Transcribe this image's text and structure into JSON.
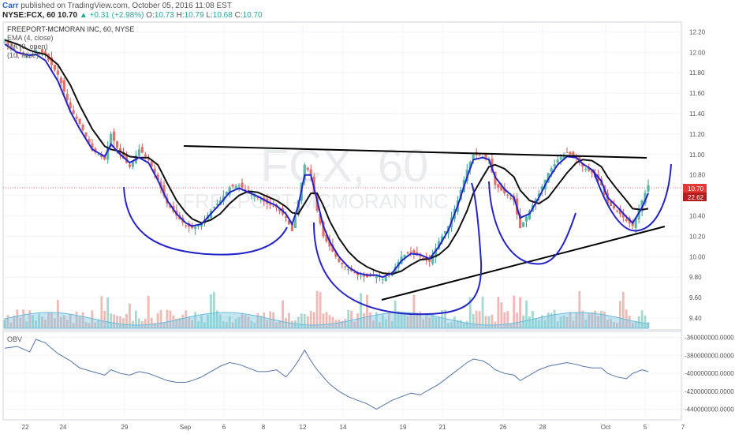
{
  "header": {
    "author": "Carr",
    "published_text": "published on TradingView.com, October 05, 2016 11:08 EST",
    "symbol": "NYSE:FCX, 60",
    "last": "10.70",
    "change": "+0.31 (+2.98%)",
    "o_label": "O:",
    "o_value": "10.73",
    "h_label": "H:",
    "h_value": "10.79",
    "l_label": "L:",
    "l_value": "10.68",
    "c_label": "C:",
    "c_value": "10.70"
  },
  "pane": {
    "title": "FREEPORT-MCMORAN INC, 60, NYSE",
    "legend": [
      "EMA (4, close)",
      "MA (9, open)",
      "(10, false)"
    ],
    "watermark_symbol": "FCX, 60",
    "watermark_name": "FREEPORT-MCMORAN INC",
    "obv_label": "OBV",
    "price_tag": "10.70",
    "price_tag_color": "#e53935",
    "secondary_tag": "22.62",
    "secondary_tag_color": "#b71c1c"
  },
  "chart_data": {
    "type": "candlestick",
    "x_ticks": [
      "22",
      "24",
      "29",
      "Sep",
      "6",
      "8",
      "12",
      "14",
      "19",
      "21",
      "26",
      "28",
      "Oct",
      "5",
      "7"
    ],
    "price_axis": {
      "ticks": [
        "12.20",
        "12.00",
        "11.80",
        "11.60",
        "11.40",
        "11.20",
        "11.00",
        "10.80",
        "10.60",
        "10.40",
        "10.20",
        "10.00",
        "9.80",
        "9.60",
        "9.40"
      ],
      "ylim": [
        9.3,
        12.28
      ]
    },
    "obv_axis": {
      "ticks": [
        "-360000000.0000",
        "-380000000.0000",
        "-400000000.0000",
        "-420000000.0000",
        "-440000000.0000"
      ],
      "ylim": [
        -450000000,
        -355000000
      ]
    },
    "price_path": [
      [
        0,
        12.1
      ],
      [
        4,
        12.0
      ],
      [
        8,
        11.95
      ],
      [
        10,
        12.02
      ],
      [
        13,
        11.97
      ],
      [
        17,
        11.78
      ],
      [
        21,
        11.45
      ],
      [
        24,
        11.3
      ],
      [
        28,
        11.05
      ],
      [
        32,
        10.95
      ],
      [
        34,
        11.2
      ],
      [
        37,
        11.0
      ],
      [
        40,
        10.88
      ],
      [
        43,
        11.05
      ],
      [
        46,
        10.95
      ],
      [
        49,
        10.75
      ],
      [
        52,
        10.52
      ],
      [
        55,
        10.4
      ],
      [
        58,
        10.3
      ],
      [
        60,
        10.28
      ],
      [
        63,
        10.32
      ],
      [
        66,
        10.45
      ],
      [
        69,
        10.55
      ],
      [
        72,
        10.68
      ],
      [
        75,
        10.7
      ],
      [
        78,
        10.62
      ],
      [
        81,
        10.58
      ],
      [
        84,
        10.52
      ],
      [
        87,
        10.48
      ],
      [
        90,
        10.38
      ],
      [
        92,
        10.25
      ],
      [
        94,
        10.55
      ],
      [
        96,
        10.9
      ],
      [
        98,
        10.8
      ],
      [
        100,
        10.45
      ],
      [
        102,
        10.2
      ],
      [
        104,
        10.1
      ],
      [
        107,
        9.95
      ],
      [
        110,
        9.88
      ],
      [
        113,
        9.82
      ],
      [
        116,
        9.8
      ],
      [
        119,
        9.82
      ],
      [
        121,
        9.78
      ],
      [
        124,
        9.85
      ],
      [
        127,
        10.0
      ],
      [
        130,
        10.05
      ],
      [
        133,
        10.0
      ],
      [
        136,
        9.95
      ],
      [
        139,
        10.15
      ],
      [
        142,
        10.3
      ],
      [
        145,
        10.55
      ],
      [
        148,
        10.85
      ],
      [
        150,
        11.0
      ],
      [
        153,
        10.98
      ],
      [
        155,
        10.95
      ],
      [
        157,
        10.7
      ],
      [
        160,
        10.62
      ],
      [
        163,
        10.55
      ],
      [
        165,
        10.28
      ],
      [
        168,
        10.45
      ],
      [
        171,
        10.62
      ],
      [
        174,
        10.82
      ],
      [
        177,
        10.95
      ],
      [
        180,
        11.02
      ],
      [
        183,
        10.96
      ],
      [
        185,
        10.88
      ],
      [
        188,
        10.82
      ],
      [
        191,
        10.7
      ],
      [
        193,
        10.52
      ],
      [
        196,
        10.45
      ],
      [
        199,
        10.35
      ],
      [
        201,
        10.3
      ],
      [
        204,
        10.55
      ],
      [
        206,
        10.7
      ]
    ],
    "ema4": [
      [
        0,
        12.08
      ],
      [
        4,
        12.0
      ],
      [
        8,
        11.97
      ],
      [
        10,
        11.98
      ],
      [
        13,
        11.92
      ],
      [
        17,
        11.72
      ],
      [
        21,
        11.42
      ],
      [
        24,
        11.25
      ],
      [
        28,
        11.05
      ],
      [
        32,
        10.98
      ],
      [
        34,
        11.1
      ],
      [
        37,
        11.0
      ],
      [
        40,
        10.92
      ],
      [
        43,
        10.97
      ],
      [
        46,
        10.92
      ],
      [
        49,
        10.75
      ],
      [
        52,
        10.55
      ],
      [
        55,
        10.42
      ],
      [
        58,
        10.33
      ],
      [
        60,
        10.3
      ],
      [
        63,
        10.32
      ],
      [
        66,
        10.42
      ],
      [
        69,
        10.52
      ],
      [
        72,
        10.63
      ],
      [
        75,
        10.67
      ],
      [
        78,
        10.63
      ],
      [
        81,
        10.59
      ],
      [
        84,
        10.54
      ],
      [
        87,
        10.5
      ],
      [
        90,
        10.42
      ],
      [
        92,
        10.32
      ],
      [
        94,
        10.5
      ],
      [
        96,
        10.8
      ],
      [
        98,
        10.8
      ],
      [
        100,
        10.55
      ],
      [
        102,
        10.3
      ],
      [
        104,
        10.15
      ],
      [
        107,
        10.0
      ],
      [
        110,
        9.9
      ],
      [
        113,
        9.84
      ],
      [
        116,
        9.82
      ],
      [
        119,
        9.82
      ],
      [
        121,
        9.8
      ],
      [
        124,
        9.84
      ],
      [
        127,
        9.96
      ],
      [
        130,
        10.03
      ],
      [
        133,
        10.02
      ],
      [
        136,
        9.98
      ],
      [
        139,
        10.1
      ],
      [
        142,
        10.26
      ],
      [
        145,
        10.5
      ],
      [
        148,
        10.78
      ],
      [
        150,
        10.95
      ],
      [
        153,
        10.97
      ],
      [
        155,
        10.95
      ],
      [
        157,
        10.78
      ],
      [
        160,
        10.66
      ],
      [
        163,
        10.58
      ],
      [
        165,
        10.38
      ],
      [
        168,
        10.42
      ],
      [
        171,
        10.58
      ],
      [
        174,
        10.76
      ],
      [
        177,
        10.9
      ],
      [
        180,
        10.98
      ],
      [
        183,
        10.97
      ],
      [
        185,
        10.91
      ],
      [
        188,
        10.85
      ],
      [
        191,
        10.74
      ],
      [
        193,
        10.58
      ],
      [
        196,
        10.49
      ],
      [
        199,
        10.39
      ],
      [
        201,
        10.33
      ],
      [
        204,
        10.48
      ],
      [
        206,
        10.62
      ]
    ],
    "ma9": [
      [
        0,
        12.12
      ],
      [
        4,
        12.08
      ],
      [
        8,
        12.02
      ],
      [
        10,
        12.0
      ],
      [
        13,
        11.98
      ],
      [
        17,
        11.88
      ],
      [
        21,
        11.68
      ],
      [
        24,
        11.48
      ],
      [
        28,
        11.25
      ],
      [
        32,
        11.08
      ],
      [
        34,
        11.05
      ],
      [
        37,
        11.03
      ],
      [
        40,
        10.98
      ],
      [
        43,
        10.97
      ],
      [
        46,
        10.97
      ],
      [
        49,
        10.9
      ],
      [
        52,
        10.72
      ],
      [
        55,
        10.55
      ],
      [
        58,
        10.43
      ],
      [
        60,
        10.37
      ],
      [
        63,
        10.33
      ],
      [
        66,
        10.36
      ],
      [
        69,
        10.42
      ],
      [
        72,
        10.52
      ],
      [
        75,
        10.6
      ],
      [
        78,
        10.64
      ],
      [
        81,
        10.63
      ],
      [
        84,
        10.59
      ],
      [
        87,
        10.55
      ],
      [
        90,
        10.49
      ],
      [
        92,
        10.43
      ],
      [
        94,
        10.42
      ],
      [
        96,
        10.52
      ],
      [
        98,
        10.62
      ],
      [
        100,
        10.62
      ],
      [
        102,
        10.5
      ],
      [
        104,
        10.35
      ],
      [
        107,
        10.18
      ],
      [
        110,
        10.05
      ],
      [
        113,
        9.96
      ],
      [
        116,
        9.9
      ],
      [
        119,
        9.86
      ],
      [
        121,
        9.84
      ],
      [
        124,
        9.83
      ],
      [
        127,
        9.86
      ],
      [
        130,
        9.92
      ],
      [
        133,
        9.97
      ],
      [
        136,
        9.98
      ],
      [
        139,
        10.02
      ],
      [
        142,
        10.1
      ],
      [
        145,
        10.25
      ],
      [
        148,
        10.45
      ],
      [
        150,
        10.62
      ],
      [
        153,
        10.78
      ],
      [
        155,
        10.88
      ],
      [
        157,
        10.9
      ],
      [
        160,
        10.86
      ],
      [
        163,
        10.78
      ],
      [
        165,
        10.65
      ],
      [
        168,
        10.55
      ],
      [
        171,
        10.52
      ],
      [
        174,
        10.58
      ],
      [
        177,
        10.7
      ],
      [
        180,
        10.82
      ],
      [
        183,
        10.92
      ],
      [
        185,
        10.95
      ],
      [
        188,
        10.94
      ],
      [
        191,
        10.88
      ],
      [
        193,
        10.78
      ],
      [
        196,
        10.66
      ],
      [
        199,
        10.55
      ],
      [
        201,
        10.47
      ],
      [
        204,
        10.46
      ],
      [
        206,
        10.47
      ]
    ],
    "obv": [
      [
        0,
        -372
      ],
      [
        4,
        -370
      ],
      [
        8,
        -376
      ],
      [
        10,
        -362
      ],
      [
        13,
        -366
      ],
      [
        17,
        -378
      ],
      [
        21,
        -386
      ],
      [
        24,
        -394
      ],
      [
        28,
        -398
      ],
      [
        32,
        -402
      ],
      [
        34,
        -396
      ],
      [
        37,
        -400
      ],
      [
        40,
        -402
      ],
      [
        43,
        -398
      ],
      [
        46,
        -400
      ],
      [
        49,
        -404
      ],
      [
        52,
        -408
      ],
      [
        55,
        -410
      ],
      [
        58,
        -410
      ],
      [
        60,
        -408
      ],
      [
        63,
        -404
      ],
      [
        66,
        -398
      ],
      [
        69,
        -392
      ],
      [
        72,
        -388
      ],
      [
        75,
        -390
      ],
      [
        78,
        -394
      ],
      [
        81,
        -398
      ],
      [
        84,
        -398
      ],
      [
        87,
        -396
      ],
      [
        90,
        -404
      ],
      [
        92,
        -396
      ],
      [
        94,
        -386
      ],
      [
        96,
        -374
      ],
      [
        98,
        -386
      ],
      [
        100,
        -396
      ],
      [
        102,
        -404
      ],
      [
        104,
        -412
      ],
      [
        107,
        -420
      ],
      [
        110,
        -426
      ],
      [
        113,
        -430
      ],
      [
        116,
        -434
      ],
      [
        119,
        -440
      ],
      [
        121,
        -436
      ],
      [
        124,
        -430
      ],
      [
        127,
        -426
      ],
      [
        130,
        -422
      ],
      [
        133,
        -424
      ],
      [
        136,
        -418
      ],
      [
        139,
        -412
      ],
      [
        142,
        -404
      ],
      [
        145,
        -396
      ],
      [
        148,
        -388
      ],
      [
        150,
        -384
      ],
      [
        153,
        -386
      ],
      [
        155,
        -390
      ],
      [
        157,
        -396
      ],
      [
        160,
        -400
      ],
      [
        163,
        -402
      ],
      [
        165,
        -408
      ],
      [
        168,
        -402
      ],
      [
        171,
        -396
      ],
      [
        174,
        -392
      ],
      [
        177,
        -390
      ],
      [
        180,
        -388
      ],
      [
        183,
        -390
      ],
      [
        185,
        -392
      ],
      [
        188,
        -394
      ],
      [
        191,
        -394
      ],
      [
        193,
        -400
      ],
      [
        196,
        -404
      ],
      [
        199,
        -406
      ],
      [
        201,
        -400
      ],
      [
        204,
        -396
      ],
      [
        206,
        -398
      ]
    ],
    "x_index_max": 215
  }
}
